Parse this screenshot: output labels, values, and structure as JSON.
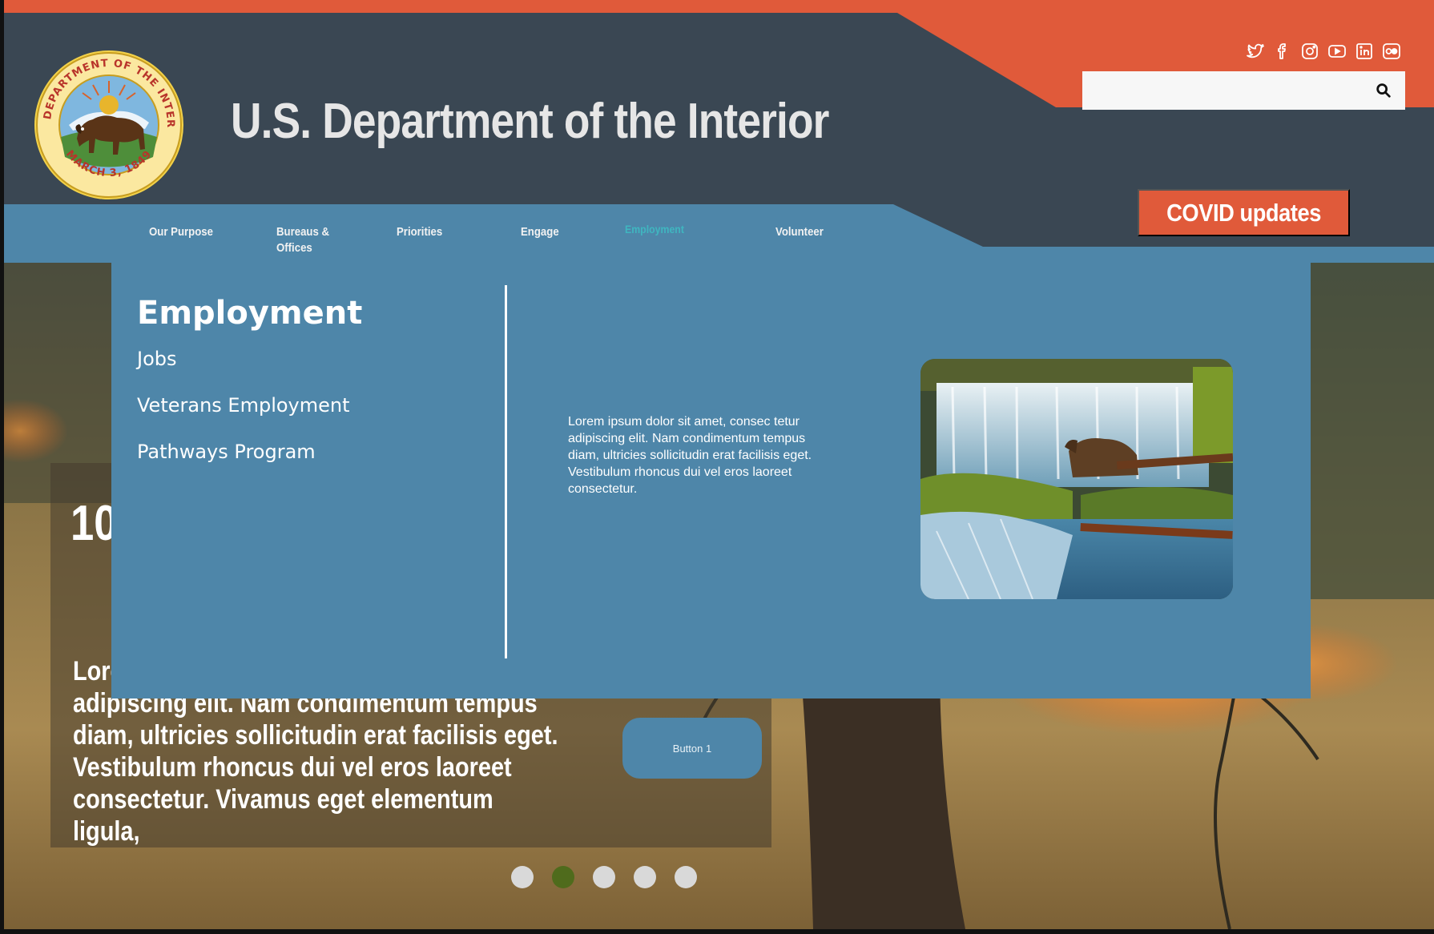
{
  "header": {
    "title": "U.S. Department of the Interior",
    "seal_text": "U.S. DEPARTMENT OF THE INTERIOR",
    "seal_date": "MARCH 3, 1849",
    "search": {
      "value": "",
      "placeholder": ""
    },
    "covid_label": "COVID updates",
    "social": [
      "twitter-icon",
      "facebook-icon",
      "instagram-icon",
      "youtube-icon",
      "linkedin-icon",
      "flickr-icon"
    ],
    "colors": {
      "accent": "#e05a3a",
      "header_bg": "#3a4753",
      "nav_bg": "#4e86a9",
      "active_nav": "#3fb6c0"
    }
  },
  "nav": {
    "items": [
      {
        "label": "Our Purpose"
      },
      {
        "label": "Bureaus &\nOffices"
      },
      {
        "label": "Priorities"
      },
      {
        "label": "Engage"
      },
      {
        "label": "Employment",
        "active": true
      },
      {
        "label": "Volunteer"
      }
    ]
  },
  "menu": {
    "title": "Employment",
    "links": [
      "Jobs",
      "Veterans Employment",
      "Pathways Program"
    ],
    "blurb": "Lorem ipsum dolor sit amet, consec tetur adipiscing elit. Nam condimentum tempus diam, ultricies sollicitudin erat facilisis eget. Vestibulum rhoncus dui vel eros laoreet consectetur."
  },
  "hero": {
    "number": "10",
    "text": "Lorem ipsum dolor sit amet, consectetur adipiscing elit. Nam condimentum tempus diam, ultricies sollicitudin erat facilisis eget. Vestibulum rhoncus dui vel eros laoreet consectetur. Vivamus eget elementum ligula,",
    "button_label": "Button 1",
    "carousel": {
      "count": 5,
      "active_index": 1
    }
  }
}
